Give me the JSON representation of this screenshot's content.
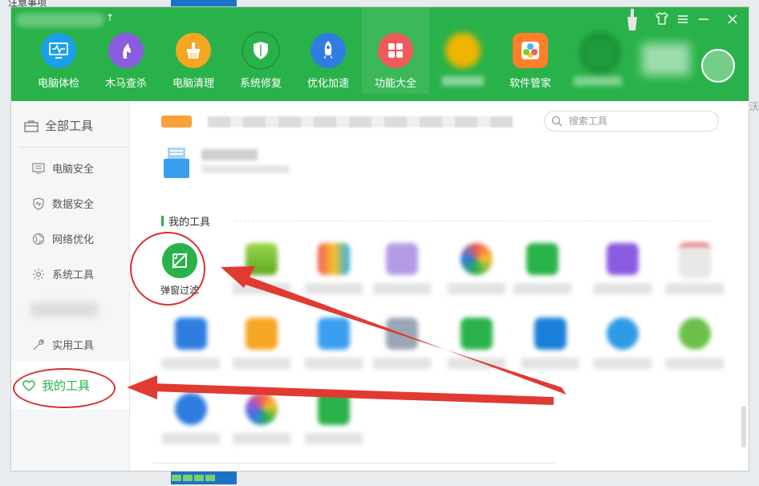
{
  "nav": {
    "items": [
      {
        "label": "电脑体检",
        "icon": "monitor-icon",
        "color": "#1aa0e8"
      },
      {
        "label": "木马查杀",
        "icon": "horse-icon",
        "color": "#8b5be0"
      },
      {
        "label": "电脑清理",
        "icon": "broom-icon",
        "color": "#f5a623"
      },
      {
        "label": "系统修复",
        "icon": "shield-icon",
        "color": "#2ab24a"
      },
      {
        "label": "优化加速",
        "icon": "rocket-icon",
        "color": "#2f7de1"
      },
      {
        "label": "功能大全",
        "icon": "grid-icon",
        "color": "#f05a5a"
      },
      {
        "label": "软件管家",
        "icon": "apps-icon",
        "color": "#ff7f2a"
      }
    ]
  },
  "sidebar": {
    "all_tools": "全部工具",
    "items": [
      {
        "label": "电脑安全",
        "icon": "monitor-list-icon"
      },
      {
        "label": "数据安全",
        "icon": "shield-pulse-icon"
      },
      {
        "label": "网络优化",
        "icon": "globe-icon"
      },
      {
        "label": "系统工具",
        "icon": "gear-icon"
      },
      {
        "label": "实用工具",
        "icon": "wrench-icon"
      }
    ],
    "my_tools": "我的工具"
  },
  "search": {
    "placeholder": "搜索工具"
  },
  "section": {
    "title": "我的工具"
  },
  "tools": {
    "popup_filter": "弹窗过滤"
  },
  "colors": {
    "brand_green": "#2ab24a",
    "annotation_red": "#d6322e"
  }
}
